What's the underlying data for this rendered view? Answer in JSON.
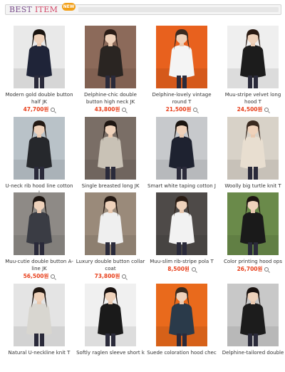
{
  "header": {
    "title_part1": "BEST",
    "title_part2": "ITEM",
    "badge": "NEW"
  },
  "colors": {
    "price": "#e8401c",
    "title_best": "#7a4e8c",
    "title_item": "#d24a6a",
    "badge": "#f2a019"
  },
  "products": [
    {
      "name": "Modern gold double button half JK",
      "price": "47,700원",
      "icon": "magnifier-icon",
      "bg": "#e9e9e9",
      "coat": "#1f2438",
      "hair": "#1a1410"
    },
    {
      "name": "Delphine-chic double button high neck JK",
      "price": "43,800원",
      "icon": "magnifier-icon",
      "bg": "#8c6a5a",
      "coat": "#2a2522",
      "hair": "#2a1c16"
    },
    {
      "name": "Delphine-lovely vintage round T",
      "price": "21,500원",
      "icon": "magnifier-icon",
      "bg": "#e8611e",
      "coat": "#f4f4f4",
      "hair": "#3a2a20"
    },
    {
      "name": "Muu-stripe velvet long hood T",
      "price": "24,500원",
      "icon": "magnifier-icon",
      "bg": "#efefef",
      "coat": "#1c1c1c",
      "hair": "#2a1a12"
    },
    {
      "name": "U-neck rib hood line cotton l",
      "price": "",
      "icon": "",
      "bg": "#b9c2c8",
      "coat": "#26282c",
      "hair": "#241a14"
    },
    {
      "name": "Single breasted long JK",
      "price": "",
      "icon": "",
      "bg": "#7a6e66",
      "coat": "#c9c2b6",
      "hair": "#1e1612"
    },
    {
      "name": "Smart white taping cotton J",
      "price": "",
      "icon": "",
      "bg": "#c7c9cc",
      "coat": "#1e2230",
      "hair": "#1a1410"
    },
    {
      "name": "Woolly big turtle knit T",
      "price": "",
      "icon": "",
      "bg": "#d8d2c8",
      "coat": "#e8ded0",
      "hair": "#3a2a20"
    },
    {
      "name": "Muu-cutie double button A-line JK",
      "price": "56,500원",
      "icon": "magnifier-icon",
      "bg": "#8e8a86",
      "coat": "#3a3c44",
      "hair": "#1c1410"
    },
    {
      "name": "Luxury double button collar coat",
      "price": "73,800원",
      "icon": "magnifier-icon",
      "bg": "#9a8a7a",
      "coat": "#efefef",
      "hair": "#241812"
    },
    {
      "name": "Muu-slim rib-stripe pola T",
      "price": "8,500원",
      "icon": "magnifier-icon",
      "bg": "#4e4a48",
      "coat": "#f2f2f2",
      "hair": "#2a1c14"
    },
    {
      "name": "Color printing hood ops",
      "price": "26,700원",
      "icon": "magnifier-icon",
      "bg": "#6a8a4a",
      "coat": "#1a1a1a",
      "hair": "#1c1410"
    },
    {
      "name": "Natural U-neckline knit T",
      "price": "",
      "icon": "",
      "bg": "#e4e4e4",
      "coat": "#d8d6d0",
      "hair": "#221812"
    },
    {
      "name": "Softly raglen sleeve short k",
      "price": "",
      "icon": "",
      "bg": "#f0f0f0",
      "coat": "#1a1a1a",
      "hair": "#1a1210"
    },
    {
      "name": "Suede coloration hood chec",
      "price": "",
      "icon": "",
      "bg": "#e96a1c",
      "coat": "#2a3a4a",
      "hair": "#3a2a1e"
    },
    {
      "name": "Delphine-tailored double but",
      "price": "",
      "icon": "",
      "bg": "#c8c8c8",
      "coat": "#1c1c1c",
      "hair": "#1a1210"
    }
  ]
}
